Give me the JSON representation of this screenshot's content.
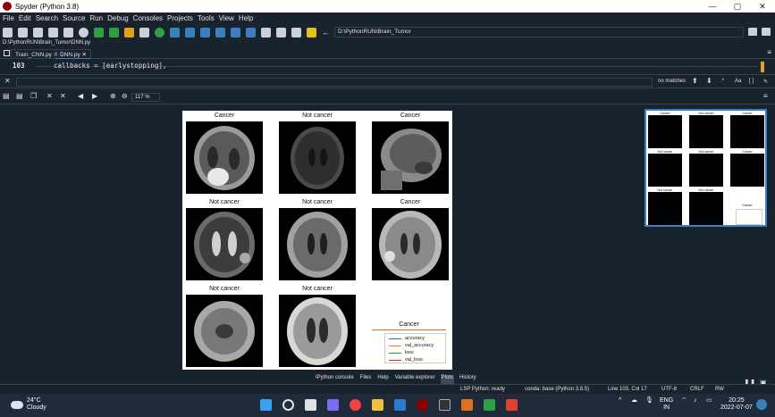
{
  "window": {
    "title": "Spyder (Python 3.8)",
    "minimize": "—",
    "maximize": "▢",
    "close": "✕"
  },
  "menu": [
    "File",
    "Edit",
    "Search",
    "Source",
    "Run",
    "Debug",
    "Consoles",
    "Projects",
    "Tools",
    "View",
    "Help"
  ],
  "toolbar": {
    "path": "D:\\PythonRUN\\Brain_Tumor"
  },
  "editor": {
    "file_path": "D:\\PythonRUN\\Brain_Tumor\\DNN.py",
    "tabs": [
      "Train_CNN.py",
      "DNN.py"
    ],
    "line_number": "103",
    "code": "callbacks = [earlystopping],"
  },
  "find": {
    "status": "no matches",
    "case_label": "Aa"
  },
  "plots": {
    "zoom": "117 %",
    "figure": {
      "subplots": [
        {
          "title": "Cancer"
        },
        {
          "title": "Not cancer"
        },
        {
          "title": "Cancer"
        },
        {
          "title": "Not cancer"
        },
        {
          "title": "Not cancer"
        },
        {
          "title": "Cancer"
        },
        {
          "title": "Not cancer"
        },
        {
          "title": "Not cancer"
        }
      ],
      "legend": {
        "title": "Cancer",
        "items": [
          {
            "label": "accuracy",
            "color": "#1f77b4"
          },
          {
            "label": "val_accuracy",
            "color": "#ff7f0e"
          },
          {
            "label": "loss",
            "color": "#2ca02c"
          },
          {
            "label": "val_loss",
            "color": "#d62728"
          }
        ]
      }
    }
  },
  "pane_tabs": [
    "IPython console",
    "Files",
    "Help",
    "Variable explorer",
    "Plots",
    "History"
  ],
  "active_pane_tab": "Plots",
  "status": {
    "lsp": "LSP Python: ready",
    "conda": "conda: base (Python 3.8.5)",
    "line_col": "Line 103, Col 17",
    "encoding": "UTF-8",
    "eol": "CRLF",
    "rw": "RW"
  },
  "taskbar": {
    "temp": "24°C",
    "weather": "Cloudy",
    "lang": "ENG",
    "region": "IN",
    "time": "20:25",
    "date": "2022-07-07"
  }
}
